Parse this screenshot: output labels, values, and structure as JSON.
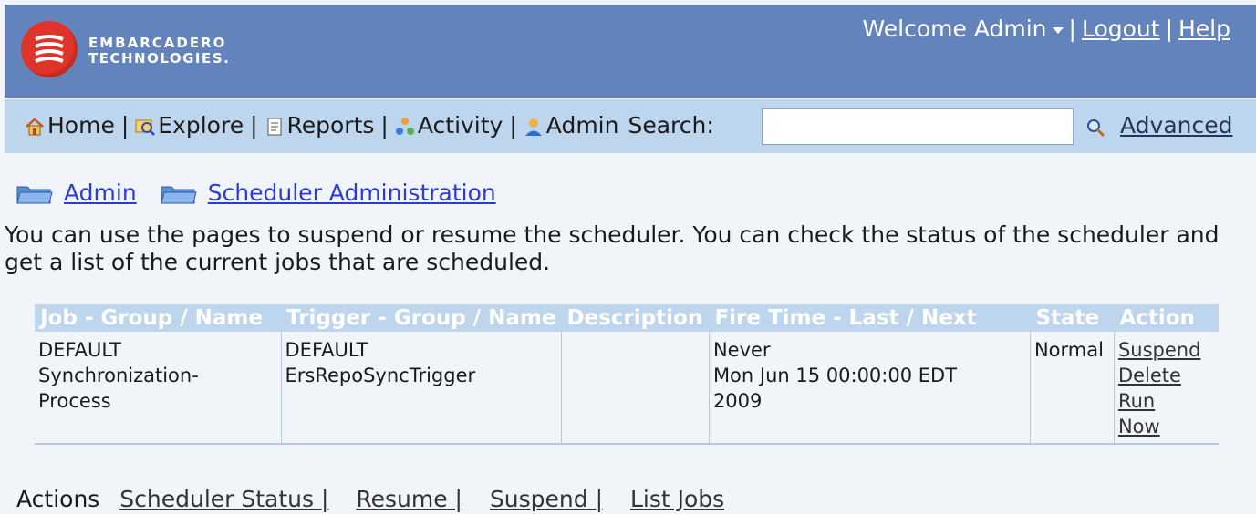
{
  "header": {
    "logo_line1": "EMBARCADERO",
    "logo_line2": "TECHNOLOGIES.",
    "welcome": "Welcome Admin",
    "logout": "Logout",
    "help": "Help",
    "separator": "|"
  },
  "nav": {
    "home": "Home",
    "explore": "Explore",
    "reports": "Reports",
    "activity": "Activity",
    "admin": "Admin",
    "search_label": "Search:",
    "search_value": "",
    "advanced": "Advanced",
    "separator": "|"
  },
  "breadcrumb": [
    {
      "label": "Admin",
      "icon": "folder-icon"
    },
    {
      "label": "Scheduler Administration",
      "icon": "folder-icon"
    }
  ],
  "description": "You can use the pages to suspend or resume the scheduler. You can check the status of the scheduler and get a list of the current jobs that are scheduled.",
  "table": {
    "headers": [
      "Job - Group / Name",
      "Trigger - Group / Name",
      "Description",
      "Fire Time - Last / Next",
      "State",
      "Action"
    ],
    "row": {
      "job_group": "DEFAULT",
      "job_name": "Synchronization-Process",
      "job_name_1": "Synchronization-",
      "job_name_2": "Process",
      "trigger_group": "DEFAULT",
      "trigger_name": "ErsRepoSyncTrigger",
      "description": "",
      "fire_last": "Never",
      "fire_next_1": "Mon Jun 15 00:00:00 EDT",
      "fire_next_2": "2009",
      "state": "Normal",
      "actions": [
        "Suspend",
        "Delete",
        "Run",
        "Now"
      ]
    }
  },
  "actions_bar": {
    "label": "Actions",
    "links": [
      "Scheduler Status |",
      "Resume |",
      "Suspend |",
      "List Jobs"
    ]
  },
  "colors": {
    "header_bg": "#6383bc",
    "nav_bg": "#bed5ee",
    "page_bg": "#f1f5fa",
    "link_blue": "#2a3bd6",
    "logo_red": "#e0342b"
  }
}
